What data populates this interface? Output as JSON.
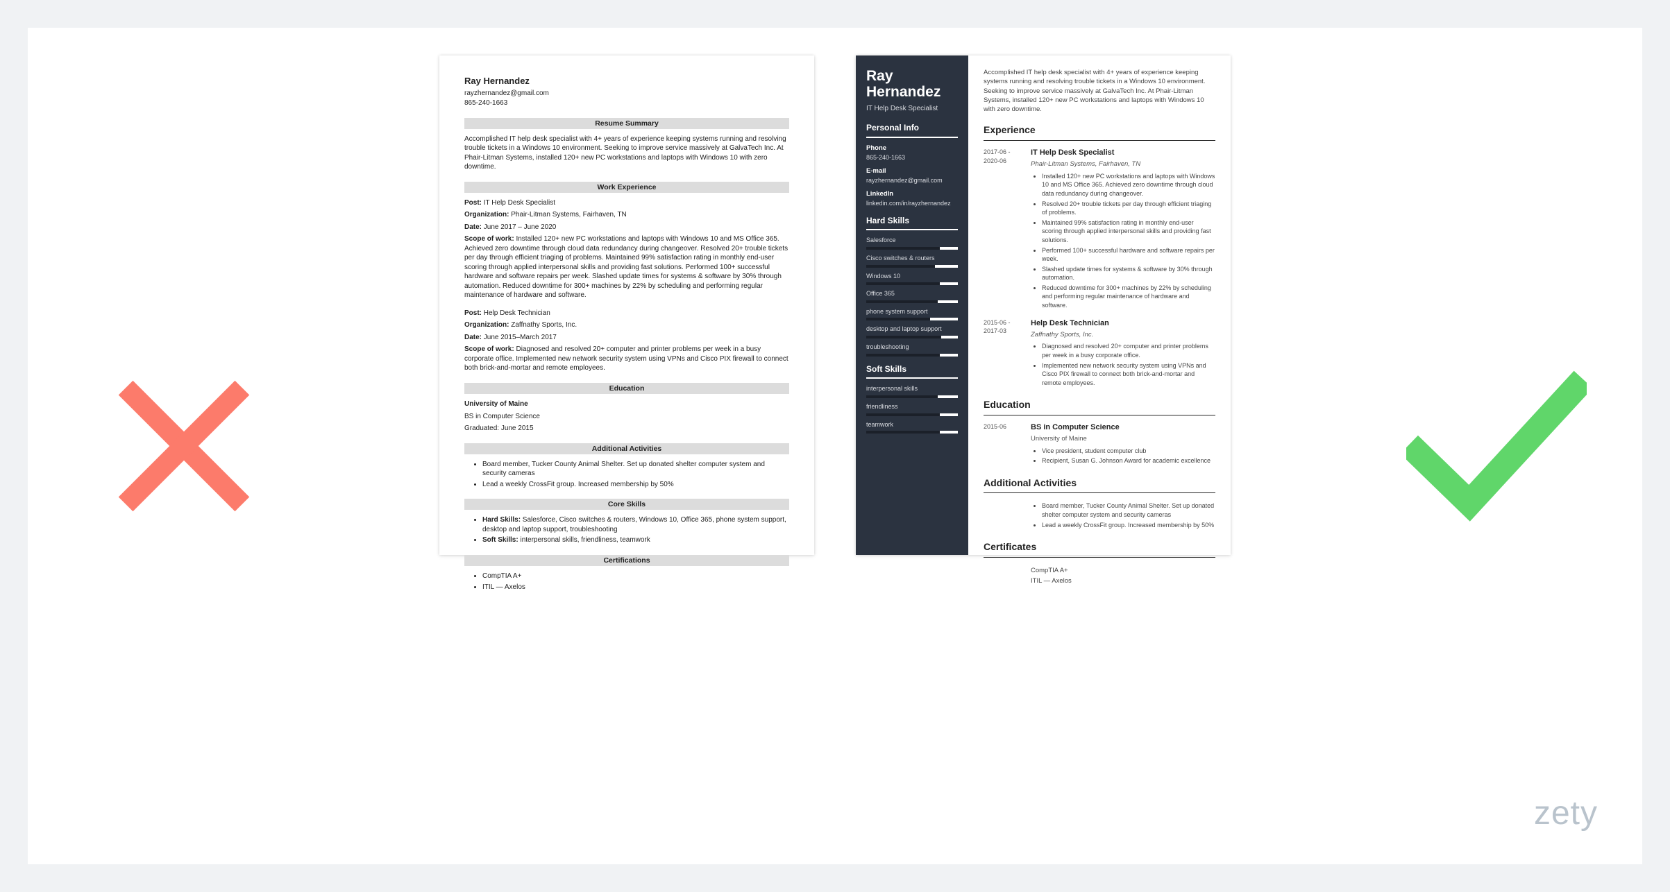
{
  "watermark": "zety",
  "left": {
    "name": "Ray Hernandez",
    "email": "rayzhernandez@gmail.com",
    "phone": "865-240-1663",
    "sections": {
      "summary_title": "Resume Summary",
      "summary_body": "Accomplished IT help desk specialist with 4+ years of experience keeping systems running and resolving trouble tickets in a Windows 10 environment. Seeking to improve service massively at GalvaTech Inc. At Phair-Litman Systems, installed 120+ new PC workstations and laptops with Windows 10 with zero downtime.",
      "work_title": "Work Experience",
      "job1": {
        "post_lbl": "Post:",
        "post": " IT Help Desk Specialist",
        "org_lbl": "Organization:",
        "org": " Phair-Litman Systems, Fairhaven, TN",
        "date_lbl": "Date:",
        "date": " June 2017 – June 2020",
        "scope_lbl": "Scope of work:",
        "scope": " Installed 120+ new PC workstations and laptops with Windows 10 and MS Office 365. Achieved zero downtime through cloud data redundancy during changeover. Resolved 20+ trouble tickets per day through efficient triaging of problems. Maintained 99% satisfaction rating in monthly end-user scoring through applied interpersonal skills and providing fast solutions. Performed 100+ successful hardware and software repairs per week. Slashed update times for systems & software by 30% through automation. Reduced downtime for 300+ machines by 22% by scheduling and performing regular maintenance of hardware and software."
      },
      "job2": {
        "post_lbl": "Post:",
        "post": " Help Desk Technician",
        "org_lbl": "Organization:",
        "org": " Zaffnathy Sports, Inc.",
        "date_lbl": "Date:",
        "date": " June 2015–March 2017",
        "scope_lbl": "Scope of work:",
        "scope": " Diagnosed and resolved 20+ computer and printer problems per week in a busy corporate office. Implemented new network security system using VPNs and Cisco PIX firewall to connect both brick-and-mortar and remote employees."
      },
      "edu_title": "Education",
      "edu_school": "University of Maine",
      "edu_degree": "BS in Computer Science",
      "edu_grad": "Graduated: June 2015",
      "act_title": "Additional Activities",
      "act1": "Board member, Tucker County Animal Shelter. Set up donated shelter computer system and security cameras",
      "act2": "Lead a weekly CrossFit group. Increased membership by 50%",
      "skills_title": "Core Skills",
      "hard_lbl": "Hard Skills:",
      "hard": " Salesforce, Cisco switches & routers, Windows 10, Office 365, phone system support, desktop and laptop support, troubleshooting",
      "soft_lbl": "Soft Skills:",
      "soft": " interpersonal skills, friendliness, teamwork",
      "cert_title": "Certifications",
      "cert1": "CompTIA A+",
      "cert2": "ITIL — Axelos"
    }
  },
  "right": {
    "sidebar": {
      "name1": "Ray",
      "name2": "Hernandez",
      "title": "IT Help Desk Specialist",
      "info_sec": "Personal Info",
      "phone_lbl": "Phone",
      "phone": "865-240-1663",
      "email_lbl": "E-mail",
      "email": "rayzhernandez@gmail.com",
      "linkedin_lbl": "LinkedIn",
      "linkedin": "linkedin.com/in/rayzhernandez",
      "hard_sec": "Hard Skills",
      "hard_skills": [
        {
          "name": "Salesforce",
          "pct": 80
        },
        {
          "name": "Cisco switches & routers",
          "pct": 75
        },
        {
          "name": "Windows 10",
          "pct": 80
        },
        {
          "name": "Office 365",
          "pct": 78
        },
        {
          "name": "phone system support",
          "pct": 70
        },
        {
          "name": "desktop and laptop support",
          "pct": 82
        },
        {
          "name": "troubleshooting",
          "pct": 80
        }
      ],
      "soft_sec": "Soft Skills",
      "soft_skills": [
        {
          "name": "interpersonal skills",
          "pct": 78
        },
        {
          "name": "friendliness",
          "pct": 80
        },
        {
          "name": "teamwork",
          "pct": 80
        }
      ]
    },
    "main": {
      "summary": "Accomplished IT help desk specialist with 4+ years of experience keeping systems running and resolving trouble tickets in a Windows 10 environment. Seeking to improve service massively at GalvaTech Inc. At Phair-Litman Systems, installed 120+ new PC workstations and laptops with Windows 10 with zero downtime.",
      "exp_title": "Experience",
      "exp": [
        {
          "dates": "2017-06 - 2020-06",
          "role": "IT Help Desk Specialist",
          "org": "Phair-Litman Systems, Fairhaven, TN",
          "bullets": [
            "Installed 120+ new PC workstations and laptops with Windows 10 and MS Office 365. Achieved zero downtime through cloud data redundancy during changeover.",
            "Resolved 20+ trouble tickets per day through efficient triaging of problems.",
            "Maintained 99% satisfaction rating in monthly end-user scoring through applied interpersonal skills and providing fast solutions.",
            "Performed 100+ successful hardware and software repairs per week.",
            "Slashed update times for systems & software by 30% through automation.",
            "Reduced downtime for 300+ machines by 22% by scheduling and performing regular maintenance of hardware and software."
          ]
        },
        {
          "dates": "2015-06 - 2017-03",
          "role": "Help Desk Technician",
          "org": "Zaffnathy Sports, Inc.",
          "bullets": [
            "Diagnosed and resolved 20+ computer and printer problems per week in a busy corporate office.",
            "Implemented new network security system using VPNs and Cisco PIX firewall to connect both brick-and-mortar and remote employees."
          ]
        }
      ],
      "edu_title": "Education",
      "edu_date": "2015-06",
      "edu_degree": "BS in Computer Science",
      "edu_school": "University of Maine",
      "edu_bullets": [
        "Vice president, student computer club",
        "Recipient, Susan G. Johnson Award for academic excellence"
      ],
      "act_title": "Additional Activities",
      "act_bullets": [
        "Board member, Tucker County Animal Shelter. Set up donated shelter computer system and security cameras",
        "Lead a weekly CrossFit group. Increased membership by 50%"
      ],
      "cert_title": "Certificates",
      "certs": [
        "CompTIA A+",
        "ITIL — Axelos"
      ]
    }
  }
}
